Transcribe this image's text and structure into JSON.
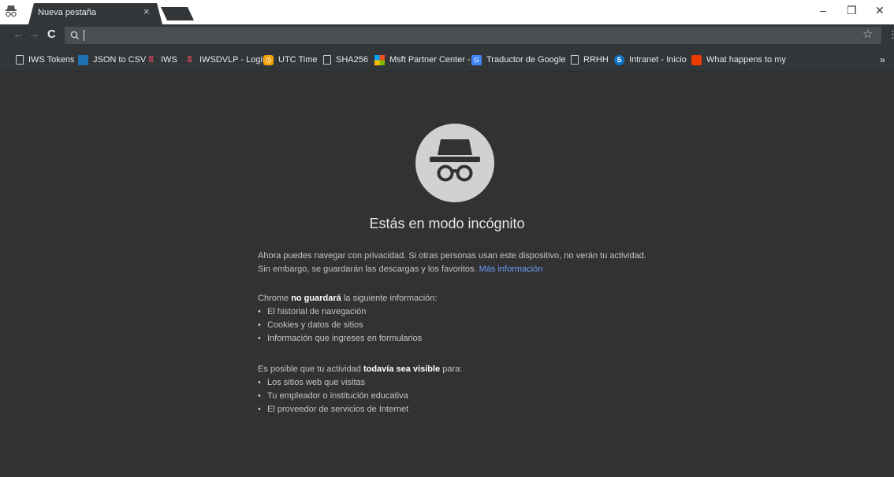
{
  "colors": {
    "content_bg": "#323232",
    "toolbar_bg": "#333639",
    "link": "#6b9ef8",
    "icon_circle": "#d1d1d1"
  },
  "tab": {
    "title": "Nueva pestaña",
    "close_glyph": "×",
    "incognito_icon": "incognito-icon"
  },
  "window": {
    "minimize_glyph": "–",
    "restore_glyph": "❐",
    "close_glyph": "✕"
  },
  "toolbar": {
    "back_glyph": "←",
    "forward_glyph": "→",
    "reload_glyph": "C",
    "omnibox_value": "",
    "star_glyph": "☆",
    "menu_glyph": "⋮"
  },
  "bookmarks": {
    "items": [
      {
        "label": "IWS Tokens",
        "icon": "page-icon"
      },
      {
        "label": "JSON to CSV",
        "icon": "blue-square-icon"
      },
      {
        "label": "IWS",
        "icon": "iws-icon"
      },
      {
        "label": "IWSDVLP - Login",
        "icon": "iws-icon"
      },
      {
        "label": "UTC Time",
        "icon": "clock-icon"
      },
      {
        "label": "SHA256",
        "icon": "page-icon"
      },
      {
        "label": "Msft Partner Center -",
        "icon": "microsoft-icon"
      },
      {
        "label": "Traductor de Google",
        "icon": "google-translate-icon"
      },
      {
        "label": "RRHH",
        "icon": "page-icon"
      },
      {
        "label": "Intranet - Inicio",
        "icon": "sharepoint-icon"
      },
      {
        "label": "What happens to my",
        "icon": "office-icon"
      }
    ],
    "more_glyph": "»"
  },
  "incognito": {
    "title": "Estás en modo incógnito",
    "intro": "Ahora puedes navegar con privacidad. Si otras personas usan este dispositivo, no verán tu actividad. Sin embargo, se guardarán las descargas y los favoritos.",
    "link": "Más información",
    "not_saved": {
      "prefix": "Chrome",
      "bold": "no guardará",
      "suffix": "la siguiente información:",
      "items": [
        "El historial de navegación",
        "Cookies y datos de sitios",
        "Información que ingreses en formularios"
      ]
    },
    "visible": {
      "prefix": "Es posible que tu actividad",
      "bold": "todavía sea visible",
      "suffix": "para:",
      "items": [
        "Los sitios web que visitas",
        "Tu empleador o institución educativa",
        "El proveedor de servicios de Internet"
      ]
    }
  }
}
